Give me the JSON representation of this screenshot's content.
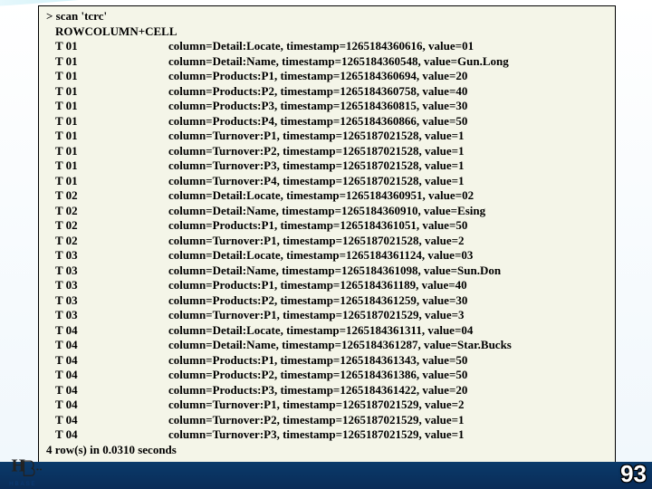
{
  "command": "> scan 'tcrc'",
  "header_row": "ROW",
  "header_col": "COLUMN+CELL",
  "rows": [
    {
      "r": "T 01",
      "c": "column=Detail:Locate, timestamp=1265184360616, value=01"
    },
    {
      "r": "T 01",
      "c": "column=Detail:Name, timestamp=1265184360548, value=Gun.Long"
    },
    {
      "r": "T 01",
      "c": "column=Products:P1, timestamp=1265184360694, value=20"
    },
    {
      "r": "T 01",
      "c": "column=Products:P2, timestamp=1265184360758, value=40"
    },
    {
      "r": "T 01",
      "c": "column=Products:P3, timestamp=1265184360815, value=30"
    },
    {
      "r": "T 01",
      "c": "column=Products:P4, timestamp=1265184360866, value=50"
    },
    {
      "r": "T 01",
      "c": "column=Turnover:P1, timestamp=1265187021528, value=1"
    },
    {
      "r": "T 01",
      "c": "column=Turnover:P2, timestamp=1265187021528, value=1"
    },
    {
      "r": "T 01",
      "c": "column=Turnover:P3, timestamp=1265187021528, value=1"
    },
    {
      "r": "T 01",
      "c": "column=Turnover:P4, timestamp=1265187021528, value=1"
    },
    {
      "r": "T 02",
      "c": "column=Detail:Locate, timestamp=1265184360951, value=02"
    },
    {
      "r": "T 02",
      "c": "column=Detail:Name, timestamp=1265184360910, value=Esing"
    },
    {
      "r": "T 02",
      "c": "column=Products:P1, timestamp=1265184361051, value=50"
    },
    {
      "r": "T 02",
      "c": "column=Turnover:P1, timestamp=1265187021528, value=2"
    },
    {
      "r": "T 03",
      "c": "column=Detail:Locate, timestamp=1265184361124, value=03"
    },
    {
      "r": "T 03",
      "c": "column=Detail:Name, timestamp=1265184361098, value=Sun.Don"
    },
    {
      "r": "T 03",
      "c": "column=Products:P1, timestamp=1265184361189, value=40"
    },
    {
      "r": "T 03",
      "c": "column=Products:P2, timestamp=1265184361259, value=30"
    },
    {
      "r": "T 03",
      "c": "column=Turnover:P1, timestamp=1265187021529, value=3"
    },
    {
      "r": "T 04",
      "c": "column=Detail:Locate, timestamp=1265184361311, value=04"
    },
    {
      "r": "T 04",
      "c": "column=Detail:Name, timestamp=1265184361287, value=Star.Bucks"
    },
    {
      "r": "T 04",
      "c": "column=Products:P1, timestamp=1265184361343, value=50"
    },
    {
      "r": "T 04",
      "c": "column=Products:P2, timestamp=1265184361386, value=50"
    },
    {
      "r": "T 04",
      "c": "column=Products:P3, timestamp=1265184361422, value=20"
    },
    {
      "r": "T 04",
      "c": "column=Turnover:P1, timestamp=1265187021529, value=2"
    },
    {
      "r": "T 04",
      "c": "column=Turnover:P2, timestamp=1265187021529, value=1"
    },
    {
      "r": "T 04",
      "c": "column=Turnover:P3, timestamp=1265187021529, value=1"
    }
  ],
  "footer": "4 row(s) in 0.0310 seconds",
  "page_number": "93",
  "logo_text": "HBASE"
}
